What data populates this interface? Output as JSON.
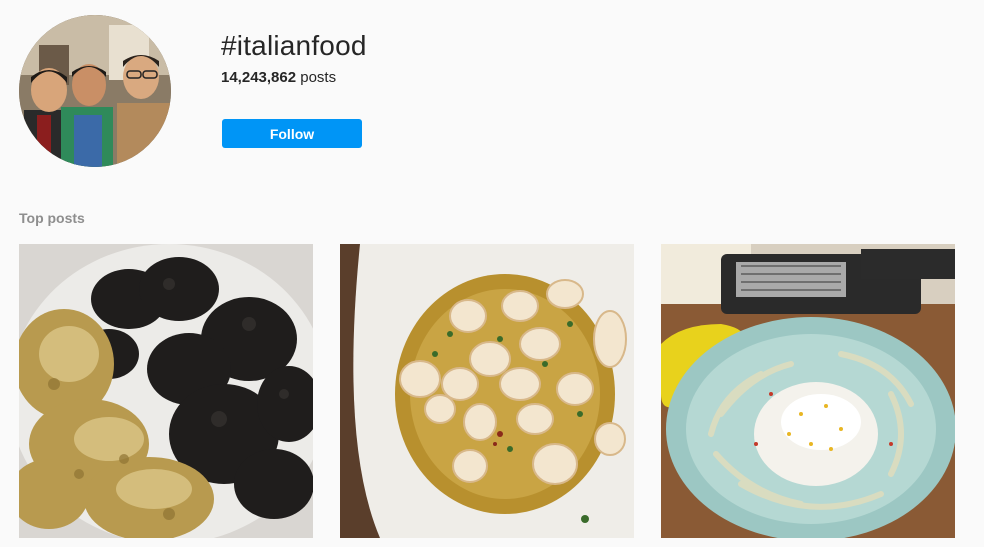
{
  "header": {
    "hashtag": "#italianfood",
    "post_count": "14,243,862",
    "post_count_suffix": " posts",
    "follow_label": "Follow"
  },
  "top_posts": {
    "section_title": "Top posts",
    "items": [
      {
        "subject": "truffles"
      },
      {
        "subject": "scallops in sauce"
      },
      {
        "subject": "burrata with fennel salad"
      }
    ]
  },
  "colors": {
    "follow_button": "#0095f6",
    "background": "#fafafa",
    "secondary_text": "#8e8e8e"
  }
}
